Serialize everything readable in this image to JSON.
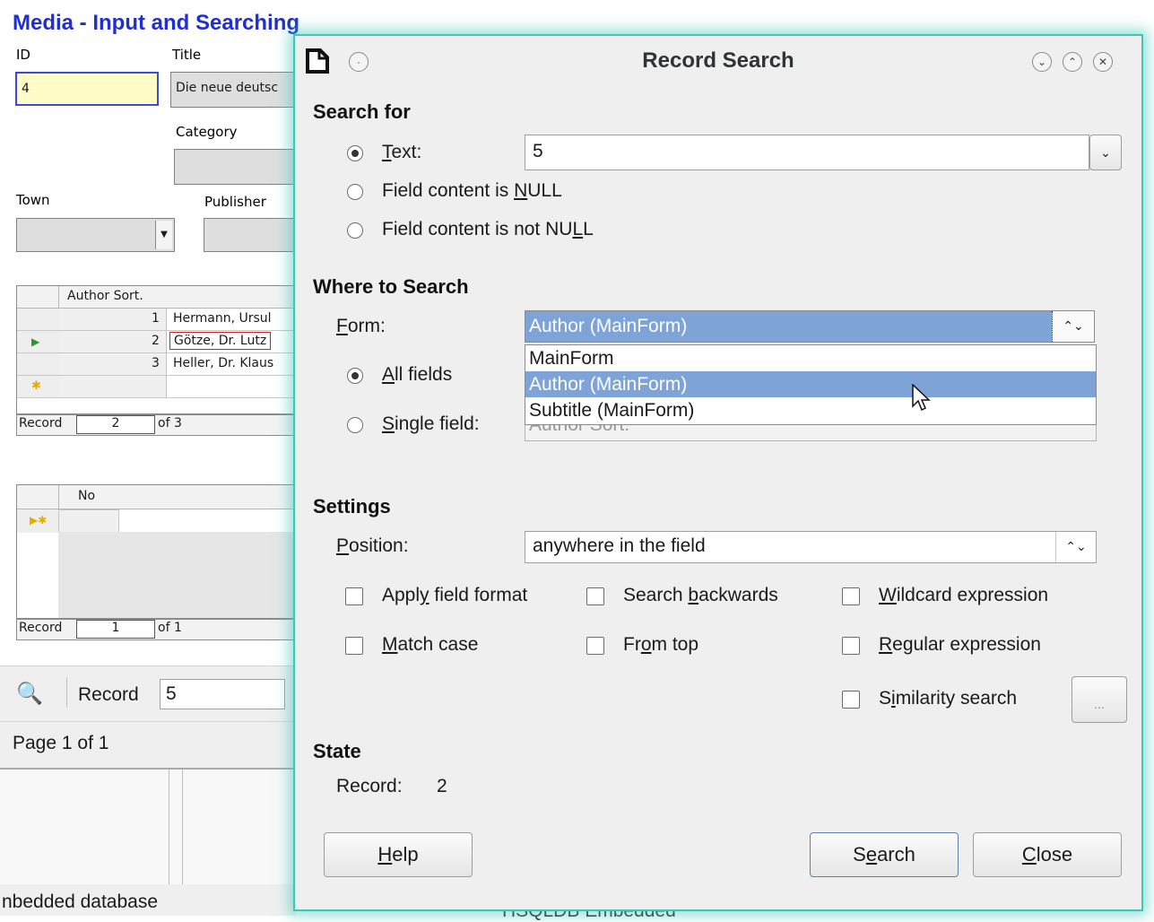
{
  "form": {
    "title": "Media - Input and Searching",
    "id_label": "ID",
    "id_value": "4",
    "title_label": "Title",
    "title_value": "Die neue deutsc",
    "category_label": "Category",
    "town_label": "Town",
    "publisher_label": "Publisher",
    "grid1": {
      "header": "Author Sort.",
      "rows": [
        {
          "no": "1",
          "name": "Hermann, Ursul"
        },
        {
          "no": "2",
          "name": "Götze, Dr. Lutz"
        },
        {
          "no": "3",
          "name": "Heller, Dr. Klaus"
        }
      ],
      "nav_label": "Record",
      "nav_value": "2",
      "nav_of": "of 3"
    },
    "grid2": {
      "header": "No",
      "nav_label": "Record",
      "nav_value": "1",
      "nav_of": "of 1"
    },
    "toolbar_record_label": "Record",
    "toolbar_record_value": "5",
    "page_status": "Page 1 of 1",
    "status_left": "nbedded database",
    "status_right": "HSQLDB Embedded"
  },
  "dialog": {
    "title": "Record Search",
    "search_for": {
      "heading": "Search for",
      "text_label_pre": "",
      "text_label_u": "T",
      "text_label_post": "ext:",
      "text_value": "5",
      "null_pre": "Field content is ",
      "null_u": "N",
      "null_post": "ULL",
      "notnull_pre": "Field content is not NU",
      "notnull_u": "L",
      "notnull_post": "L"
    },
    "where": {
      "heading": "Where to Search",
      "form_label_u": "F",
      "form_label_post": "orm:",
      "form_value": "Author (MainForm)",
      "options": [
        "MainForm",
        "Author (MainForm)",
        "Subtitle (MainForm)"
      ],
      "selected_option": "Author (MainForm)",
      "all_fields_u": "A",
      "all_fields_post": "ll fields",
      "single_field_u": "S",
      "single_field_post": "ingle field:",
      "single_field_value": "Author Sort."
    },
    "settings": {
      "heading": "Settings",
      "position_label_u": "P",
      "position_label_post": "osition:",
      "position_value": "anywhere in the field",
      "apply_format_pre": "Appl",
      "apply_format_u": "y",
      "apply_format_post": " field format",
      "search_back_pre": "Search ",
      "search_back_u": "b",
      "search_back_post": "ackwards",
      "wildcard_u": "W",
      "wildcard_post": "ildcard expression",
      "match_case_u": "M",
      "match_case_post": "atch case",
      "from_top_pre": "Fr",
      "from_top_u": "o",
      "from_top_post": "m top",
      "regex_u": "R",
      "regex_post": "egular expression",
      "similarity_pre": "S",
      "similarity_u": "i",
      "similarity_post": "milarity search",
      "similarity_btn": "..."
    },
    "state": {
      "heading": "State",
      "record_label": "Record:",
      "record_value": "2"
    },
    "buttons": {
      "help_u": "H",
      "help_post": "elp",
      "search_pre": "S",
      "search_u": "e",
      "search_post": "arch",
      "close_u": "C",
      "close_post": "lose"
    }
  }
}
